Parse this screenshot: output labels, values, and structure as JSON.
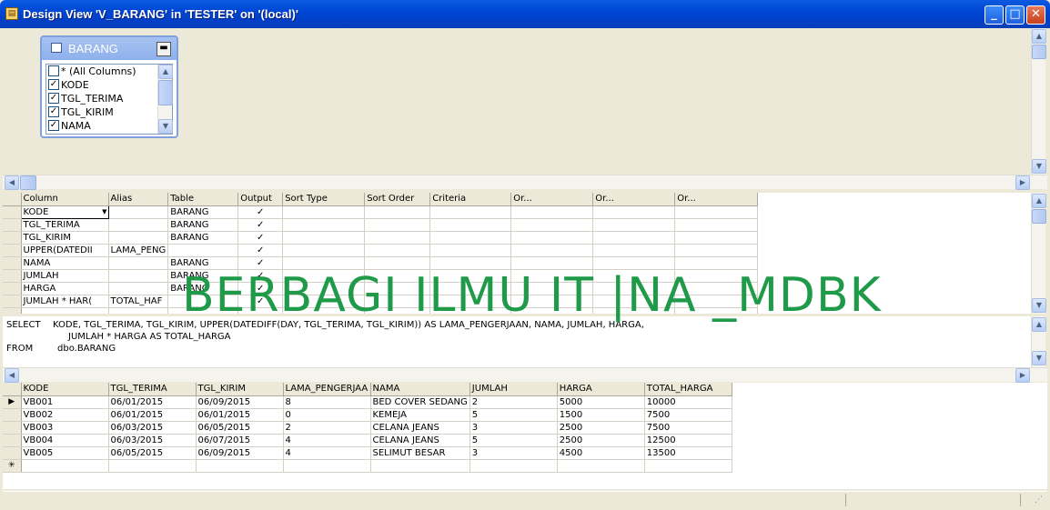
{
  "window": {
    "title": "Design View 'V_BARANG' in 'TESTER' on '(local)'",
    "app_icon": "query-designer-icon"
  },
  "diagram": {
    "table_name": "BARANG",
    "columns": [
      {
        "label": "* (All Columns)",
        "checked": false
      },
      {
        "label": "KODE",
        "checked": true
      },
      {
        "label": "TGL_TERIMA",
        "checked": true
      },
      {
        "label": "TGL_KIRIM",
        "checked": true
      },
      {
        "label": "NAMA",
        "checked": true
      }
    ]
  },
  "grid": {
    "headers": [
      "Column",
      "Alias",
      "Table",
      "Output",
      "Sort Type",
      "Sort Order",
      "Criteria",
      "Or...",
      "Or...",
      "Or..."
    ],
    "rows": [
      {
        "column": "KODE",
        "alias": "",
        "table": "BARANG",
        "output": "✓"
      },
      {
        "column": "TGL_TERIMA",
        "alias": "",
        "table": "BARANG",
        "output": "✓"
      },
      {
        "column": "TGL_KIRIM",
        "alias": "",
        "table": "BARANG",
        "output": "✓"
      },
      {
        "column": "UPPER(DATEDII",
        "alias": "LAMA_PENG",
        "table": "",
        "output": "✓"
      },
      {
        "column": "NAMA",
        "alias": "",
        "table": "BARANG",
        "output": "✓"
      },
      {
        "column": "JUMLAH",
        "alias": "",
        "table": "BARANG",
        "output": "✓"
      },
      {
        "column": "HARGA",
        "alias": "",
        "table": "BARANG",
        "output": "✓"
      },
      {
        "column": "JUMLAH * HAR(",
        "alias": "TOTAL_HAF",
        "table": "",
        "output": "✓"
      }
    ]
  },
  "sql": {
    "kw_select": "SELECT",
    "line1": "KODE, TGL_TERIMA, TGL_KIRIM, UPPER(DATEDIFF(DAY, TGL_TERIMA, TGL_KIRIM)) AS LAMA_PENGERJAAN, NAMA, JUMLAH, HARGA,",
    "line2": "JUMLAH * HARGA AS TOTAL_HARGA",
    "kw_from": "FROM",
    "line3": "dbo.BARANG"
  },
  "results": {
    "headers": [
      "KODE",
      "TGL_TERIMA",
      "TGL_KIRIM",
      "LAMA_PENGERJAA",
      "NAMA",
      "JUMLAH",
      "HARGA",
      "TOTAL_HARGA"
    ],
    "rows": [
      [
        "VB001",
        "06/01/2015",
        "06/09/2015",
        "8",
        "BED COVER SEDANG",
        "2",
        "5000",
        "10000"
      ],
      [
        "VB002",
        "06/01/2015",
        "06/01/2015",
        "0",
        "KEMEJA",
        "5",
        "1500",
        "7500"
      ],
      [
        "VB003",
        "06/03/2015",
        "06/05/2015",
        "2",
        "CELANA JEANS",
        "3",
        "2500",
        "7500"
      ],
      [
        "VB004",
        "06/03/2015",
        "06/07/2015",
        "4",
        "CELANA JEANS",
        "5",
        "2500",
        "12500"
      ],
      [
        "VB005",
        "06/05/2015",
        "06/09/2015",
        "4",
        "SELIMUT BESAR",
        "3",
        "4500",
        "13500"
      ]
    ],
    "new_row_marker": "✳",
    "current_row_marker": "▶"
  },
  "watermark": "BERBAGI ILMU IT |NA _MDBK"
}
